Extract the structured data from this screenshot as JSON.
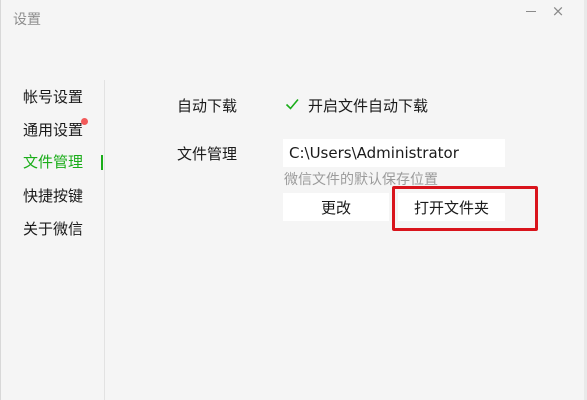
{
  "window": {
    "title": "设置",
    "close_glyph": "×"
  },
  "sidebar": {
    "items": [
      {
        "label": "帐号设置"
      },
      {
        "label": "通用设置"
      },
      {
        "label": "文件管理"
      },
      {
        "label": "快捷按键"
      },
      {
        "label": "关于微信"
      }
    ],
    "active_index": 2
  },
  "main": {
    "auto_download": {
      "label": "自动下载",
      "checkbox_label": "开启文件自动下载",
      "checked": true
    },
    "file_management": {
      "label": "文件管理",
      "path": "C:\\Users\\Administrator",
      "hint": "微信文件的默认保存位置",
      "change_button": "更改",
      "open_folder_button": "打开文件夹"
    }
  },
  "colors": {
    "accent": "#1aad19",
    "highlight": "#d9141c",
    "badge": "#f25a5a"
  }
}
